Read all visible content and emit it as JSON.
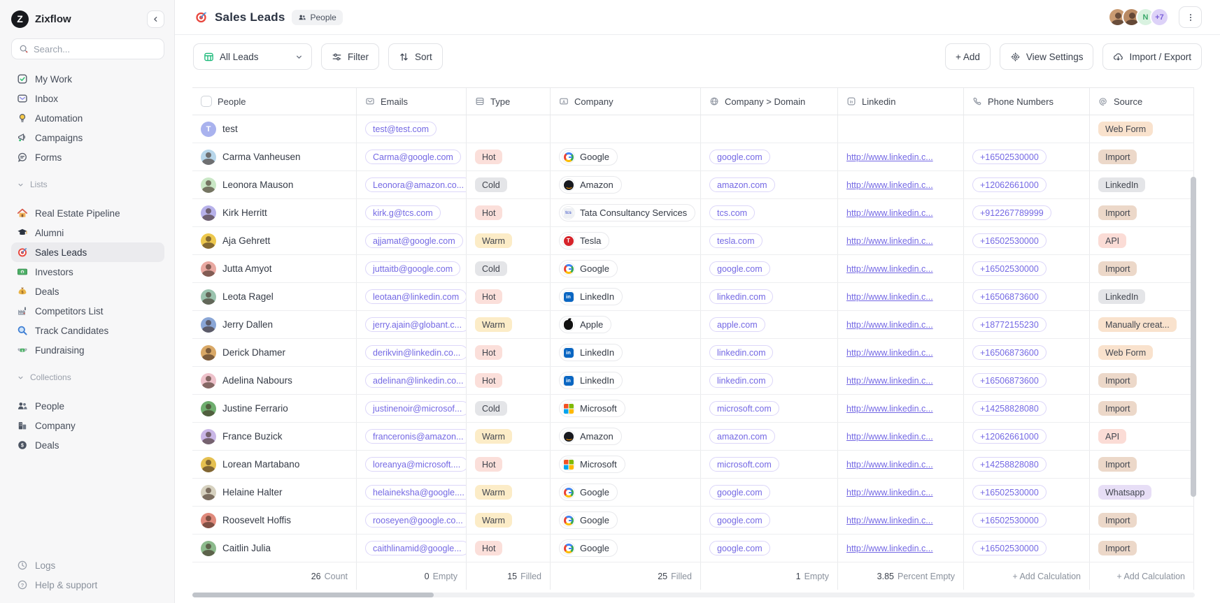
{
  "app": {
    "name": "Zixflow"
  },
  "sidebar": {
    "search_placeholder": "Search...",
    "nav": [
      {
        "label": "My Work",
        "icon": "my-work"
      },
      {
        "label": "Inbox",
        "icon": "inbox"
      },
      {
        "label": "Automation",
        "icon": "bulb"
      },
      {
        "label": "Campaigns",
        "icon": "megaphone"
      },
      {
        "label": "Forms",
        "icon": "forms"
      }
    ],
    "sections": [
      {
        "label": "Lists",
        "items": [
          {
            "label": "Real Estate Pipeline",
            "icon": "home"
          },
          {
            "label": "Alumni",
            "icon": "grad-cap"
          },
          {
            "label": "Sales Leads",
            "icon": "target"
          },
          {
            "label": "Investors",
            "icon": "banknote"
          },
          {
            "label": "Deals",
            "icon": "moneybag"
          },
          {
            "label": "Competitors List",
            "icon": "factory"
          },
          {
            "label": "Track Candidates",
            "icon": "magnifier"
          },
          {
            "label": "Fundraising",
            "icon": "money-wings"
          }
        ]
      },
      {
        "label": "Collections",
        "items": [
          {
            "label": "People",
            "icon": "people-dark"
          },
          {
            "label": "Company",
            "icon": "building-dark"
          },
          {
            "label": "Deals",
            "icon": "dollar-circle"
          }
        ]
      }
    ],
    "footer": [
      {
        "label": "Logs",
        "icon": "clock"
      },
      {
        "label": "Help & support",
        "icon": "question-circle"
      }
    ]
  },
  "header": {
    "title": "Sales Leads",
    "title_icon": "target",
    "badge": {
      "label": "People",
      "icon": "people-badge"
    },
    "avatars": [
      {
        "type": "photo",
        "bg": "#c99b72"
      },
      {
        "type": "photo",
        "bg": "#b98a63"
      },
      {
        "type": "initial",
        "label": "N",
        "bg": "#d9f2e0",
        "color": "#3aa86b"
      },
      {
        "type": "count",
        "label": "+7",
        "bg": "#ddd2f8",
        "color": "#7a5fd8"
      }
    ]
  },
  "toolbar": {
    "view_selector_label": "All Leads",
    "view_selector_icon": "grid-green",
    "filter_label": "Filter",
    "sort_label": "Sort",
    "add_label": "+ Add",
    "view_settings_label": "View Settings",
    "import_export_label": "Import / Export"
  },
  "table": {
    "columns": [
      {
        "key": "people",
        "label": "People",
        "icon": "checkbox"
      },
      {
        "key": "email",
        "label": "Emails",
        "icon": "mail"
      },
      {
        "key": "type",
        "label": "Type",
        "icon": "rows"
      },
      {
        "key": "company",
        "label": "Company",
        "icon": "text-field"
      },
      {
        "key": "domain",
        "label": "Company > Domain",
        "icon": "globe"
      },
      {
        "key": "linkedin",
        "label": "Linkedin",
        "icon": "linkedin-sq"
      },
      {
        "key": "phone",
        "label": "Phone Numbers",
        "icon": "phone"
      },
      {
        "key": "source",
        "label": "Source",
        "icon": "spiral"
      }
    ],
    "rows": [
      {
        "name": "test",
        "avatar_bg": "#a9b2ee",
        "avatar_initial": "T",
        "email": "test@test.com",
        "type": "",
        "company": "",
        "company_logo": "",
        "domain": "",
        "linkedin": "",
        "phone": "",
        "source": "Web Form",
        "source_style": "peach"
      },
      {
        "name": "Carma Vanheusen",
        "avatar_bg": "#b7d6ea",
        "email": "Carma@google.com",
        "type": "Hot",
        "company": "Google",
        "company_logo": "google",
        "domain": "google.com",
        "linkedin": "http://www.linkedin.c...",
        "phone": "+16502530000",
        "source": "Import",
        "source_style": "tan"
      },
      {
        "name": "Leonora Mauson",
        "avatar_bg": "#c9e7c5",
        "email": "Leonora@amazon.co...",
        "type": "Cold",
        "company": "Amazon",
        "company_logo": "amazon",
        "domain": "amazon.com",
        "linkedin": "http://www.linkedin.c...",
        "phone": "+12062661000",
        "source": "LinkedIn",
        "source_style": "gray"
      },
      {
        "name": "Kirk Herritt",
        "avatar_bg": "#b7b1ea",
        "email": "kirk.g@tcs.com",
        "type": "Hot",
        "company": "Tata Consultancy Services",
        "company_logo": "tcs",
        "domain": "tcs.com",
        "linkedin": "http://www.linkedin.c...",
        "phone": "+912267789999",
        "source": "Import",
        "source_style": "tan"
      },
      {
        "name": "Aja Gehrett",
        "avatar_bg": "#edc84d",
        "email": "ajjamat@google.com",
        "type": "Warm",
        "company": "Tesla",
        "company_logo": "tesla",
        "domain": "tesla.com",
        "linkedin": "http://www.linkedin.c...",
        "phone": "+16502530000",
        "source": "API",
        "source_style": "pink"
      },
      {
        "name": "Jutta Amyot",
        "avatar_bg": "#e9a9a2",
        "email": "juttaitb@google.com",
        "type": "Cold",
        "company": "Google",
        "company_logo": "google",
        "domain": "google.com",
        "linkedin": "http://www.linkedin.c...",
        "phone": "+16502530000",
        "source": "Import",
        "source_style": "tan"
      },
      {
        "name": "Leota Ragel",
        "avatar_bg": "#9ac3ae",
        "email": "leotaan@linkedin.com",
        "type": "Hot",
        "company": "LinkedIn",
        "company_logo": "linkedin",
        "domain": "linkedin.com",
        "linkedin": "http://www.linkedin.c...",
        "phone": "+16506873600",
        "source": "LinkedIn",
        "source_style": "gray"
      },
      {
        "name": "Jerry Dallen",
        "avatar_bg": "#8aa6d6",
        "email": "jerry.ajain@globant.c...",
        "type": "Warm",
        "company": "Apple",
        "company_logo": "apple",
        "domain": "apple.com",
        "linkedin": "http://www.linkedin.c...",
        "phone": "+18772155230",
        "source": "Manually creat...",
        "source_style": "peach"
      },
      {
        "name": "Derick Dhamer",
        "avatar_bg": "#d9a866",
        "email": "derikvin@linkedin.co...",
        "type": "Hot",
        "company": "LinkedIn",
        "company_logo": "linkedin",
        "domain": "linkedin.com",
        "linkedin": "http://www.linkedin.c...",
        "phone": "+16506873600",
        "source": "Web Form",
        "source_style": "peach"
      },
      {
        "name": "Adelina Nabours",
        "avatar_bg": "#eec2cb",
        "email": "adelinan@linkedin.co...",
        "type": "Hot",
        "company": "LinkedIn",
        "company_logo": "linkedin",
        "domain": "linkedin.com",
        "linkedin": "http://www.linkedin.c...",
        "phone": "+16506873600",
        "source": "Import",
        "source_style": "tan"
      },
      {
        "name": "Justine Ferrario",
        "avatar_bg": "#6fae6f",
        "email": "justinenoir@microsof...",
        "type": "Cold",
        "company": "Microsoft",
        "company_logo": "microsoft",
        "domain": "microsoft.com",
        "linkedin": "http://www.linkedin.c...",
        "phone": "+14258828080",
        "source": "Import",
        "source_style": "tan"
      },
      {
        "name": "France Buzick",
        "avatar_bg": "#c9b6e6",
        "email": "franceronis@amazon...",
        "type": "Warm",
        "company": "Amazon",
        "company_logo": "amazon",
        "domain": "amazon.com",
        "linkedin": "http://www.linkedin.c...",
        "phone": "+12062661000",
        "source": "API",
        "source_style": "pink"
      },
      {
        "name": "Lorean Martabano",
        "avatar_bg": "#e5c050",
        "email": "loreanya@microsoft....",
        "type": "Hot",
        "company": "Microsoft",
        "company_logo": "microsoft",
        "domain": "microsoft.com",
        "linkedin": "http://www.linkedin.c...",
        "phone": "+14258828080",
        "source": "Import",
        "source_style": "tan"
      },
      {
        "name": "Helaine Halter",
        "avatar_bg": "#d6d1bf",
        "email": "helaineksha@google....",
        "type": "Warm",
        "company": "Google",
        "company_logo": "google",
        "domain": "google.com",
        "linkedin": "http://www.linkedin.c...",
        "phone": "+16502530000",
        "source": "Whatsapp",
        "source_style": "purple"
      },
      {
        "name": "Roosevelt Hoffis",
        "avatar_bg": "#e08a7c",
        "email": "rooseyen@google.co...",
        "type": "Warm",
        "company": "Google",
        "company_logo": "google",
        "domain": "google.com",
        "linkedin": "http://www.linkedin.c...",
        "phone": "+16502530000",
        "source": "Import",
        "source_style": "tan"
      },
      {
        "name": "Caitlin Julia",
        "avatar_bg": "#8cba8c",
        "email": "caithlinamid@google...",
        "type": "Hot",
        "company": "Google",
        "company_logo": "google",
        "domain": "google.com",
        "linkedin": "http://www.linkedin.c...",
        "phone": "+16502530000",
        "source": "Import",
        "source_style": "tan"
      }
    ],
    "footer": [
      {
        "value": "26",
        "label": "Count"
      },
      {
        "value": "0",
        "label": "Empty"
      },
      {
        "value": "15",
        "label": "Filled"
      },
      {
        "value": "25",
        "label": "Filled"
      },
      {
        "value": "1",
        "label": "Empty"
      },
      {
        "value": "3.85",
        "label": "Percent Empty"
      },
      {
        "value": "",
        "label": "+ Add Calculation"
      },
      {
        "value": "",
        "label": "+ Add Calculation"
      }
    ]
  },
  "colors": {
    "accent_purple": "#7468e4",
    "hot_bg": "#fbdfda",
    "warm_bg": "#fcecc7",
    "cold_bg": "#e4e5e8",
    "source_peach": "#f9e2cd",
    "source_tan": "#ecd8c9",
    "source_pink": "#fbdcd6",
    "source_purple": "#e7def6",
    "green_icon": "#17b877"
  }
}
